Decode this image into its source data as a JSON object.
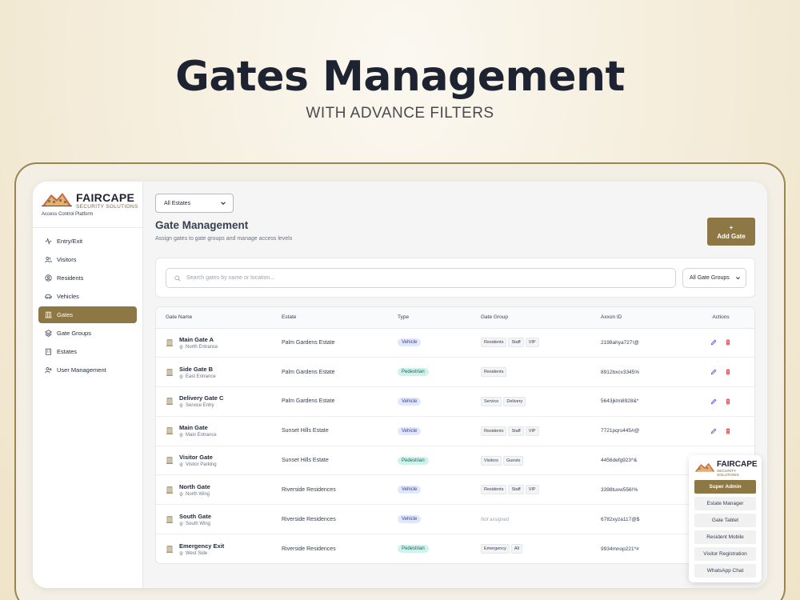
{
  "hero": {
    "title": "Gates Management",
    "subtitle": "WITH ADVANCE FILTERS"
  },
  "brand": {
    "name": "FAIRCAPE",
    "tagline": "SECURITY SOLUTIONS",
    "platform": "Access Control Platform"
  },
  "sidebar": {
    "items": [
      {
        "label": "Entry/Exit",
        "icon": "activity-icon"
      },
      {
        "label": "Visitors",
        "icon": "users-icon"
      },
      {
        "label": "Residents",
        "icon": "user-circle-icon"
      },
      {
        "label": "Vehicles",
        "icon": "car-icon"
      },
      {
        "label": "Gates",
        "icon": "gate-icon",
        "active": true
      },
      {
        "label": "Gate Groups",
        "icon": "layers-icon"
      },
      {
        "label": "Estates",
        "icon": "building-icon"
      },
      {
        "label": "User Management",
        "icon": "user-cog-icon"
      }
    ]
  },
  "main": {
    "estate_filter": "All Estates",
    "title": "Gate Management",
    "description": "Assign gates to gate groups and manage access levels",
    "add_button": {
      "icon": "+",
      "label": "Add Gate"
    },
    "search_placeholder": "Search gates by name or location...",
    "group_filter": "All Gate Groups"
  },
  "table": {
    "headers": [
      "Gate Name",
      "Estate",
      "Type",
      "Gate Group",
      "Axxon ID",
      "Actions"
    ],
    "rows": [
      {
        "name": "Main Gate A",
        "location": "North Entrance",
        "estate": "Palm Gardens Estate",
        "type": "Vehicle",
        "groups": [
          "Residents",
          "Staff",
          "VIP"
        ],
        "axxon": "2198ahya727!@"
      },
      {
        "name": "Side Gate B",
        "location": "East Entrance",
        "estate": "Palm Gardens Estate",
        "type": "Pedestrian",
        "groups": [
          "Residents"
        ],
        "axxon": "8912bxcv3345%"
      },
      {
        "name": "Delivery Gate C",
        "location": "Service Entry",
        "estate": "Palm Gardens Estate",
        "type": "Vehicle",
        "groups": [
          "Service",
          "Delivery"
        ],
        "axxon": "5643jklm8928&*"
      },
      {
        "name": "Main Gate",
        "location": "Main Entrance",
        "estate": "Sunset Hills Estate",
        "type": "Vehicle",
        "groups": [
          "Residents",
          "Staff",
          "VIP"
        ],
        "axxon": "7721pqrs445#@"
      },
      {
        "name": "Visitor Gate",
        "location": "Visitor Parking",
        "estate": "Sunset Hills Estate",
        "type": "Pedestrian",
        "groups": [
          "Visitors",
          "Guests"
        ],
        "axxon": "4456defg923^&"
      },
      {
        "name": "North Gate",
        "location": "North Wing",
        "estate": "Riverside Residences",
        "type": "Vehicle",
        "groups": [
          "Residents",
          "Staff",
          "VIP"
        ],
        "axxon": "3398tuvw556!%"
      },
      {
        "name": "South Gate",
        "location": "South Wing",
        "estate": "Riverside Residences",
        "type": "Vehicle",
        "groups": [],
        "groups_empty": "Not assigned",
        "axxon": "6782xyza117@$"
      },
      {
        "name": "Emergency Exit",
        "location": "West Side",
        "estate": "Riverside Residences",
        "type": "Pedestrian",
        "groups": [
          "Emergency",
          "All"
        ],
        "axxon": "9934mnop221*#"
      }
    ]
  },
  "portal": {
    "brand_name": "FAIRCAPE",
    "brand_tagline": "SECURITY SOLUTIONS",
    "items": [
      "Super Admin",
      "Estate Manager",
      "Gate Tablet",
      "Resident Mobile",
      "Visitor Registration",
      "WhatsApp Chat"
    ],
    "active_index": 0
  },
  "colors": {
    "accent": "#8c7745",
    "vehicle_pill": "#e0e7ff",
    "pedestrian_pill": "#d1f2ec",
    "delete_icon": "#dc2626",
    "edit_icon": "#4f46e5"
  }
}
